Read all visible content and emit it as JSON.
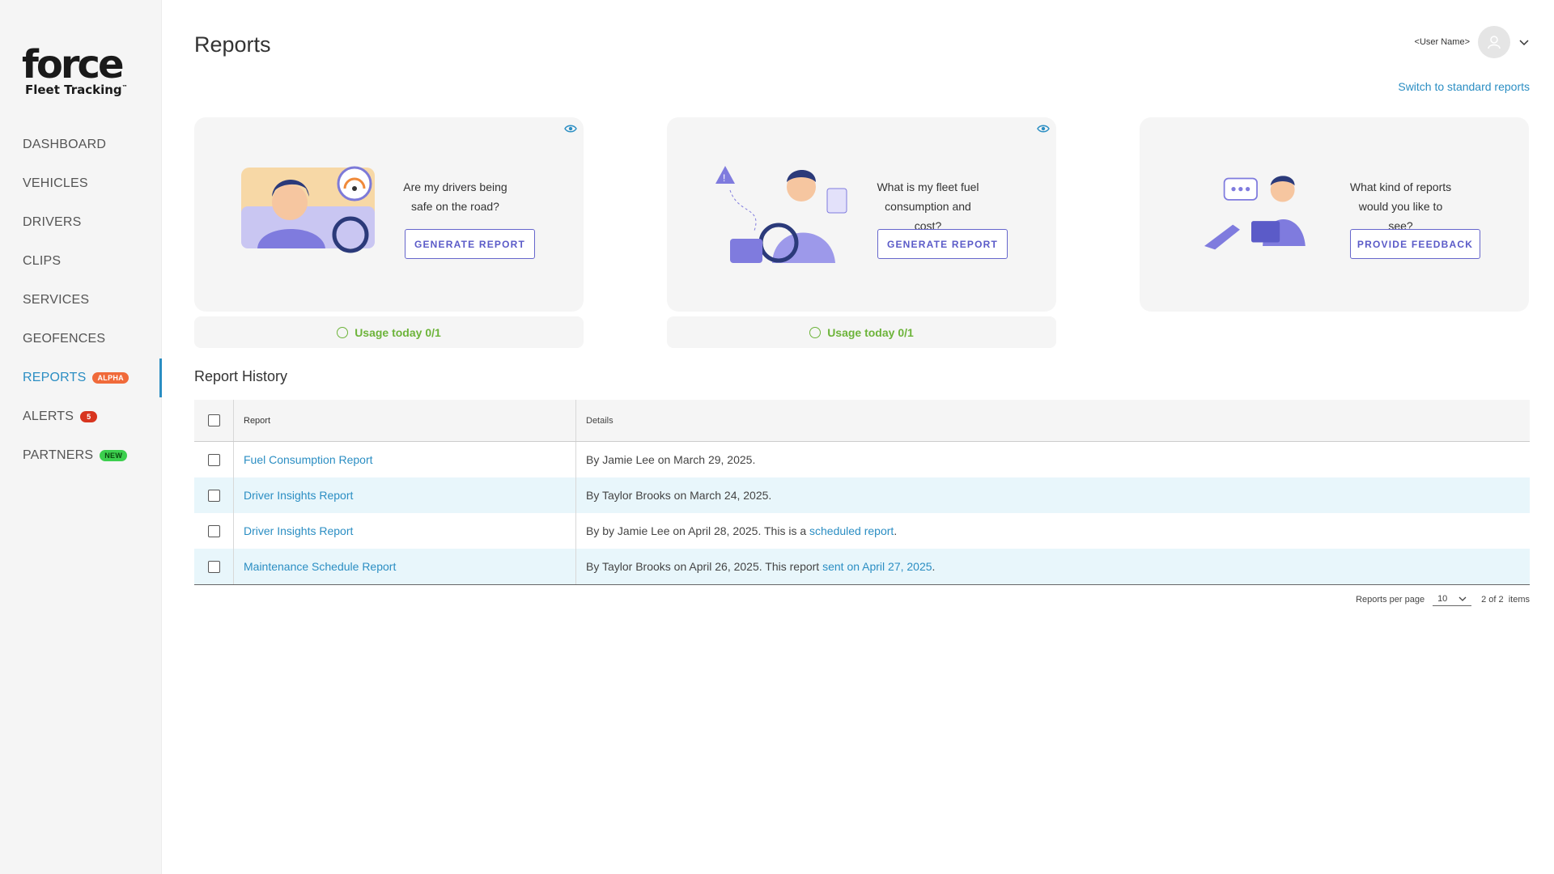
{
  "brand": {
    "word": "force",
    "sub": "Fleet Tracking",
    "tm": "™"
  },
  "nav": [
    {
      "label": "DASHBOARD"
    },
    {
      "label": "VEHICLES"
    },
    {
      "label": "DRIVERS"
    },
    {
      "label": "CLIPS"
    },
    {
      "label": "SERVICES"
    },
    {
      "label": "GEOFENCES"
    },
    {
      "label": "REPORTS",
      "badge": "ALPHA"
    },
    {
      "label": "ALERTS",
      "badge": "5"
    },
    {
      "label": "PARTNERS",
      "badge": "NEW"
    }
  ],
  "header": {
    "title": "Reports",
    "user_name": "<User Name>",
    "switch_link": "Switch to standard reports"
  },
  "cards": [
    {
      "question": "Are my drivers being safe on the road?",
      "button": "GENERATE REPORT",
      "usage": "Usage today 0/1"
    },
    {
      "question": "What is my fleet fuel consumption and cost?",
      "button": "GENERATE REPORT",
      "usage": "Usage today 0/1"
    },
    {
      "question": "What kind of reports would you like to see?",
      "button": "PROVIDE FEEDBACK"
    }
  ],
  "history": {
    "title": "Report History",
    "columns": {
      "report": "Report",
      "details": "Details"
    },
    "rows": [
      {
        "report": "Fuel Consumption Report",
        "details": "By Jamie Lee on March 29, 2025.",
        "link": "",
        "after": ""
      },
      {
        "report": "Driver Insights Report",
        "details": "By Taylor Brooks on March 24, 2025.",
        "link": "",
        "after": ""
      },
      {
        "report": "Driver Insights Report",
        "details": "By by Jamie Lee on April 28, 2025. This is a ",
        "link": "scheduled report",
        "after": "."
      },
      {
        "report": "Maintenance Schedule Report",
        "details": "By Taylor Brooks on April 26, 2025. This report ",
        "link": "sent on April 27, 2025",
        "after": "."
      }
    ]
  },
  "pager": {
    "label": "Reports per page",
    "per_page": "10",
    "count": "2 of 2",
    "items": "items"
  },
  "colors": {
    "accent": "#2b8ec3",
    "button": "#5b5bc8",
    "usage": "#6db43a",
    "row_alt": "#e8f6fb"
  }
}
